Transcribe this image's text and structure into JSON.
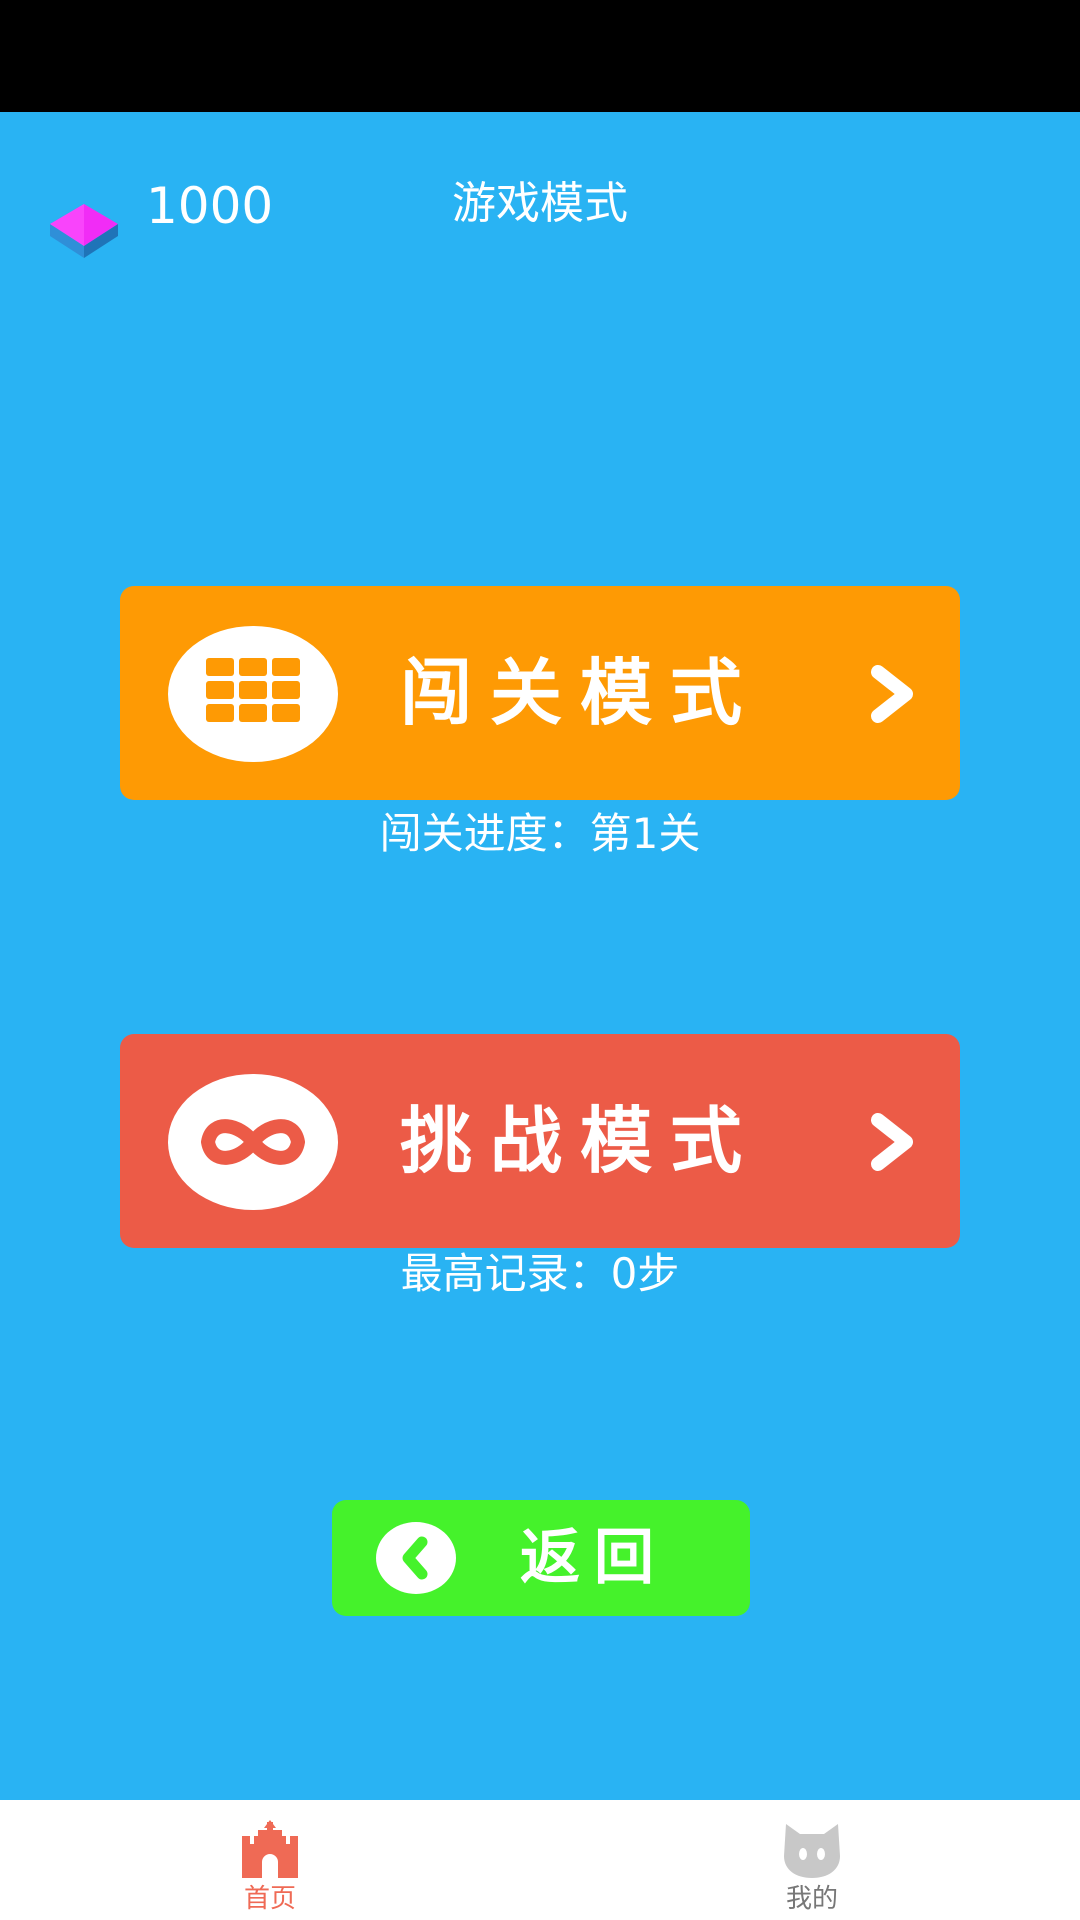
{
  "header": {
    "gem_count": "1000",
    "title": "游戏模式"
  },
  "modes": {
    "level": {
      "label": "闯关模式",
      "caption": "闯关进度：第1关",
      "color": "#fe9a04",
      "icon": "grid-icon"
    },
    "challenge": {
      "label": "挑战模式",
      "caption": "最高记录：0步",
      "color": "#ec5b47",
      "icon": "infinity-icon"
    }
  },
  "back_button": {
    "label": "返回",
    "color": "#45f22b",
    "icon": "chevron-left-icon"
  },
  "bottom_nav": {
    "items": [
      {
        "label": "首页",
        "icon": "castle-icon",
        "active": true
      },
      {
        "label": "我的",
        "icon": "cat-face-icon",
        "active": false
      }
    ],
    "active_color": "#ef6a55"
  },
  "colors": {
    "background": "#29b3f3",
    "status_bar": "#000000"
  }
}
